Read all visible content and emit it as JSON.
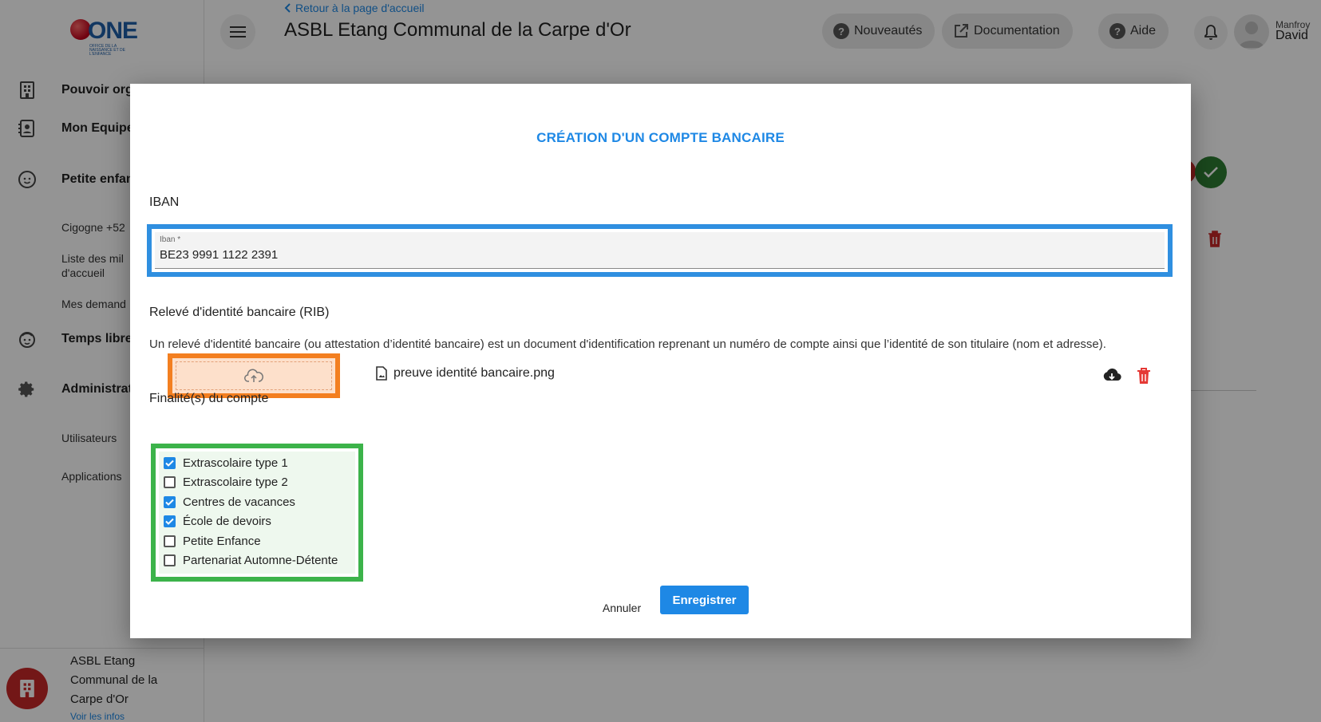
{
  "app": {
    "logo_text": "ONE",
    "logo_subtitle": "OFFICE DE LA NAISSANCE ET DE L'ENFANCE",
    "back_link": "Retour à la page d'accueil",
    "page_title": "ASBL Etang Communal de la Carpe d'Or"
  },
  "header": {
    "news": "Nouveautés",
    "docs": "Documentation",
    "help": "Aide",
    "user_first": "Manfroy",
    "user_last": "David"
  },
  "sidebar": {
    "items": [
      {
        "label": "Pouvoir org",
        "icon": "building-icon"
      },
      {
        "label": "Mon Equipe",
        "icon": "contact-card-icon"
      },
      {
        "label": "Petite enfan",
        "icon": "baby-face-icon"
      },
      {
        "label": "Cigogne +52"
      },
      {
        "label": "Liste des mil\nd'accueil"
      },
      {
        "label": "Mes demand"
      },
      {
        "label": "Temps libre",
        "icon": "child-face-icon"
      },
      {
        "label": "Administrat",
        "icon": "gear-icon"
      },
      {
        "label": "Utilisateurs"
      },
      {
        "label": "Applications"
      }
    ],
    "org_name": "ASBL Etang Communal de la Carpe d'Or",
    "org_link": "Voir les infos"
  },
  "modal": {
    "title": "CRÉATION D'UN COMPTE BANCAIRE",
    "iban_section": "IBAN",
    "iban_label": "Iban *",
    "iban_value": "BE23 9991 1122 2391",
    "rib_section": "Relevé d'identité bancaire (RIB)",
    "rib_description": "Un relevé d'identité bancaire (ou attestation d’identité bancaire) est un document d'identification reprenant un numéro de compte ainsi que l’identité de son titulaire (nom et adresse).",
    "file_name": "preuve identité bancaire.png",
    "purposes_section": "Finalité(s) du compte",
    "purposes": [
      {
        "label": "Extrascolaire type 1",
        "checked": true
      },
      {
        "label": "Extrascolaire type 2",
        "checked": false
      },
      {
        "label": "Centres de vacances",
        "checked": true
      },
      {
        "label": "École de devoirs",
        "checked": true
      },
      {
        "label": "Petite Enfance",
        "checked": false
      },
      {
        "label": "Partenariat Automne-Détente",
        "checked": false
      }
    ],
    "cancel": "Annuler",
    "save": "Enregistrer"
  },
  "colors": {
    "accent": "#1e88e5",
    "iban_highlight": "#2f8fe0",
    "upload_highlight": "#f37f20",
    "purpose_highlight": "#3cb34a",
    "danger": "#e53935",
    "success": "#2e7d32"
  }
}
